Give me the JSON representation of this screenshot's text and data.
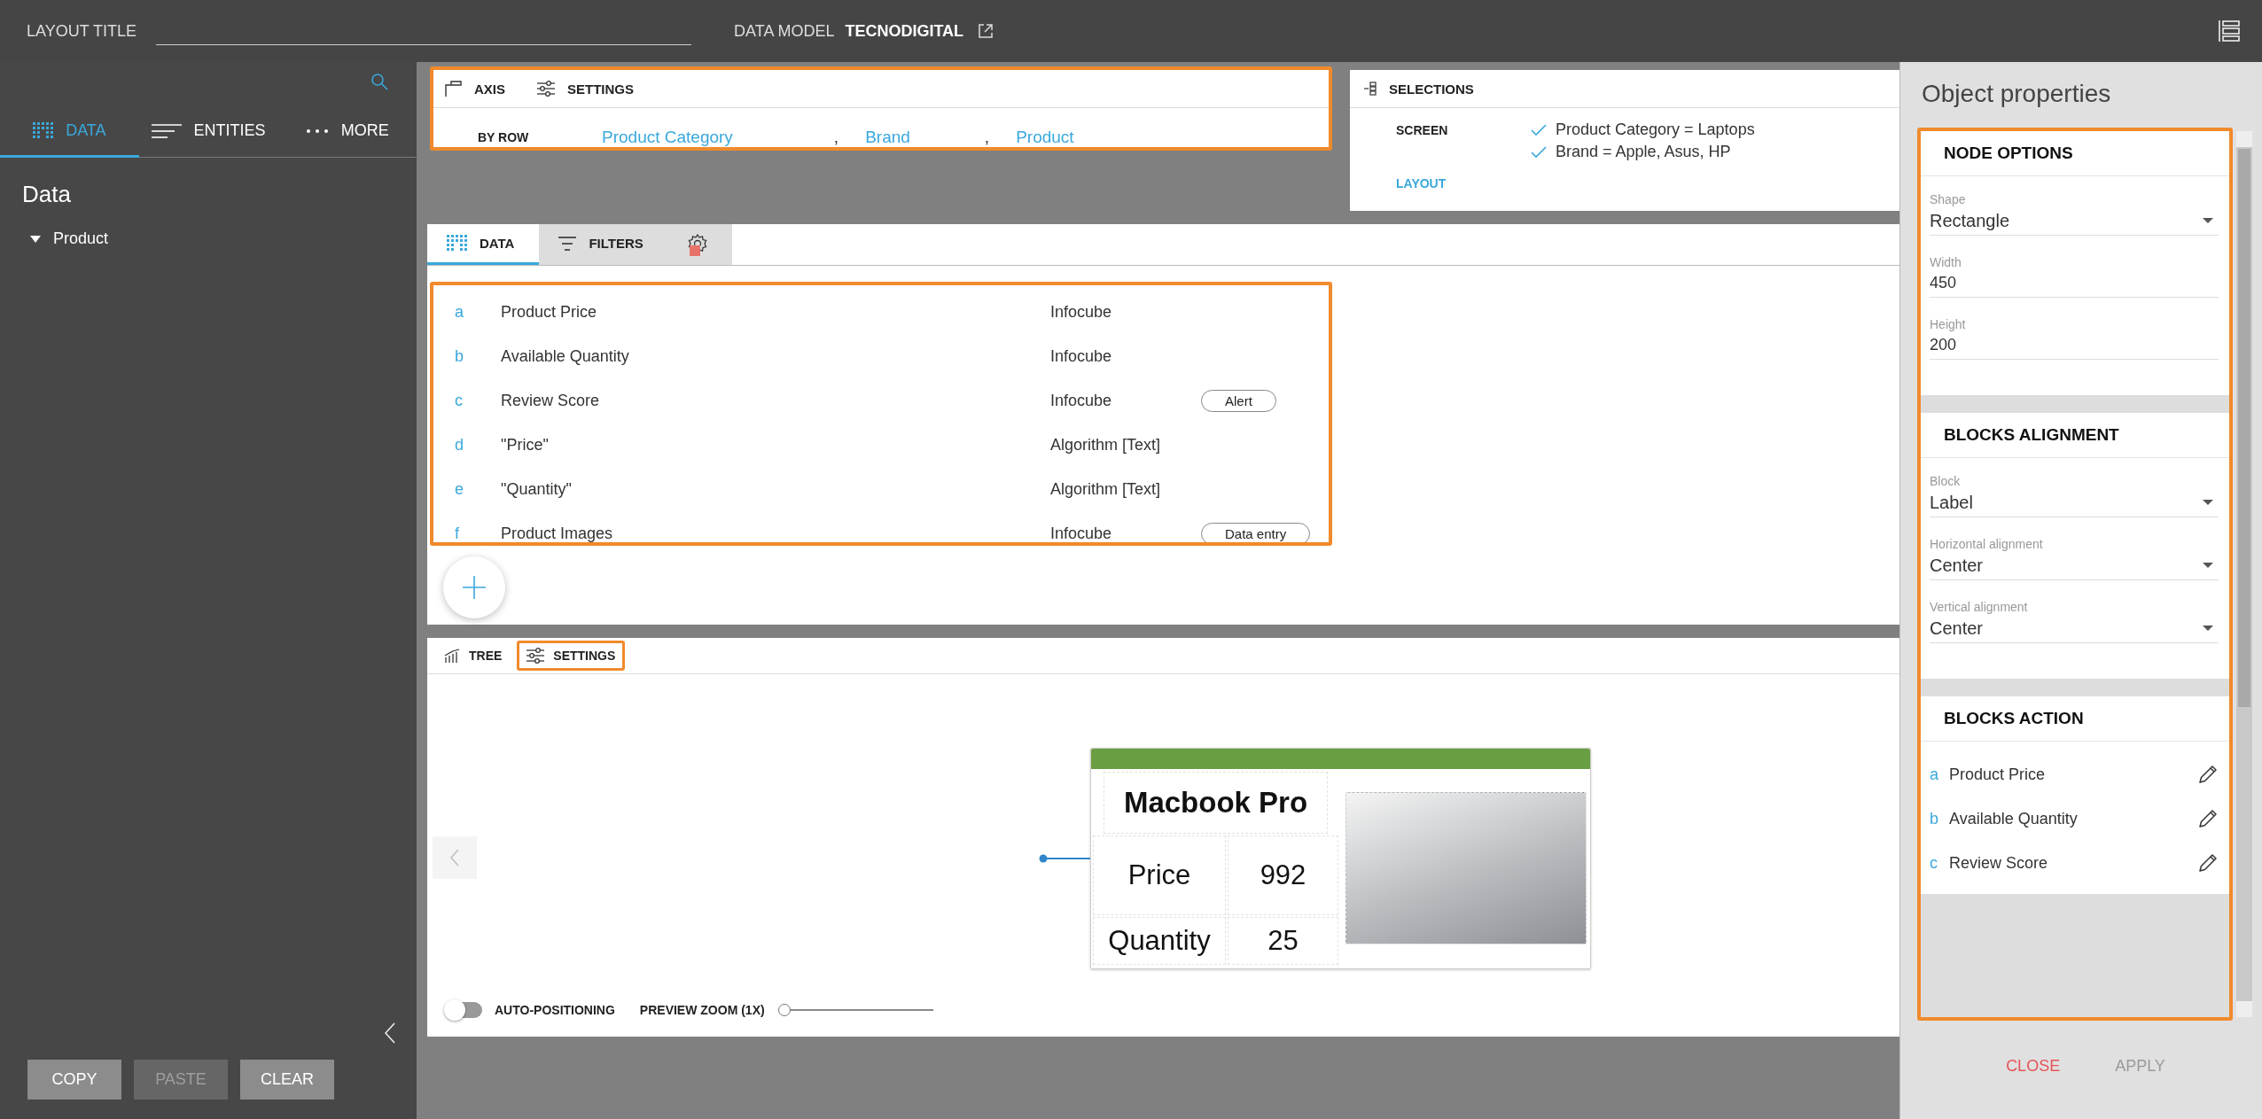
{
  "header": {
    "layout_title_label": "LAYOUT TITLE",
    "data_model_label": "DATA MODEL",
    "data_model_name": "TECNODIGITAL"
  },
  "sidebar": {
    "tabs": [
      {
        "label": "DATA",
        "selected": true
      },
      {
        "label": "ENTITIES",
        "selected": false
      },
      {
        "label": "MORE",
        "selected": false
      }
    ],
    "heading": "Data",
    "tree": [
      {
        "label": "Product",
        "expanded": true
      }
    ],
    "buttons": [
      {
        "label": "COPY",
        "disabled": false
      },
      {
        "label": "PASTE",
        "disabled": true
      },
      {
        "label": "CLEAR",
        "disabled": false
      }
    ]
  },
  "axis": {
    "highlighted": true,
    "tabs": [
      "AXIS",
      "SETTINGS"
    ],
    "row_label": "BY ROW",
    "fields": [
      {
        "label": "Product Category"
      },
      {
        "separator": ",",
        "label": "Brand"
      },
      {
        "separator": ",",
        "label": "Product"
      }
    ]
  },
  "selections": {
    "title": "SELECTIONS",
    "rows": [
      {
        "label": "SCREEN",
        "highlighted": false,
        "items": [
          "Product Category = Laptops",
          "Brand = Apple, Asus, HP"
        ]
      },
      {
        "label": "LAYOUT",
        "highlighted": true
      }
    ]
  },
  "data_panel": {
    "tabs": [
      {
        "kind": "text",
        "label": "DATA",
        "selected": true
      },
      {
        "kind": "text",
        "label": "FILTERS",
        "selected": false
      },
      {
        "kind": "icon",
        "selected": false,
        "alert": true
      }
    ],
    "highlighted": true,
    "rows": [
      {
        "letter": "a",
        "name": "Product Price",
        "source": "Infocube"
      },
      {
        "letter": "b",
        "name": "Available Quantity",
        "source": "Infocube"
      },
      {
        "letter": "c",
        "name": "Review Score",
        "source": "Infocube",
        "tag": "Alert"
      },
      {
        "letter": "d",
        "name": "\"Price\"",
        "source": "Algorithm [Text]"
      },
      {
        "letter": "e",
        "name": "\"Quantity\"",
        "source": "Algorithm [Text]"
      },
      {
        "letter": "f",
        "name": "Product Images",
        "source": "Infocube",
        "tag": "Data entry"
      }
    ]
  },
  "tree_panel": {
    "tabs": [
      {
        "label": "TREE",
        "highlighted": false
      },
      {
        "label": "SETTINGS",
        "highlighted": true
      }
    ],
    "node": {
      "title": "Macbook Pro",
      "cells": [
        {
          "label": "Price",
          "value": "992"
        },
        {
          "label": "Quantity",
          "value": "25"
        }
      ]
    },
    "auto_positioning": {
      "label": "AUTO-POSITIONING",
      "on": false
    },
    "preview_zoom": {
      "label": "PREVIEW ZOOM (1X)",
      "level": 0
    }
  },
  "properties": {
    "title": "Object properties",
    "highlighted": true,
    "sections": [
      {
        "title": "NODE OPTIONS",
        "fields": [
          {
            "kind": "select",
            "label": "Shape",
            "value": "Rectangle"
          },
          {
            "kind": "input",
            "label": "Width",
            "value": "450"
          },
          {
            "kind": "input",
            "label": "Height",
            "value": "200"
          }
        ]
      },
      {
        "title": "BLOCKS ALIGNMENT",
        "fields": [
          {
            "kind": "select",
            "label": "Block",
            "value": "Label"
          },
          {
            "kind": "select",
            "label": "Horizontal alignment",
            "value": "Center"
          },
          {
            "kind": "select",
            "label": "Vertical alignment",
            "value": "Center"
          }
        ]
      },
      {
        "title": "BLOCKS ACTION",
        "actions": [
          {
            "letter": "a",
            "name": "Product Price"
          },
          {
            "letter": "b",
            "name": "Available Quantity"
          },
          {
            "letter": "c",
            "name": "Review Score"
          }
        ]
      }
    ],
    "buttons": [
      {
        "label": "CLOSE",
        "disabled": false
      },
      {
        "label": "APPLY",
        "disabled": true
      }
    ]
  }
}
